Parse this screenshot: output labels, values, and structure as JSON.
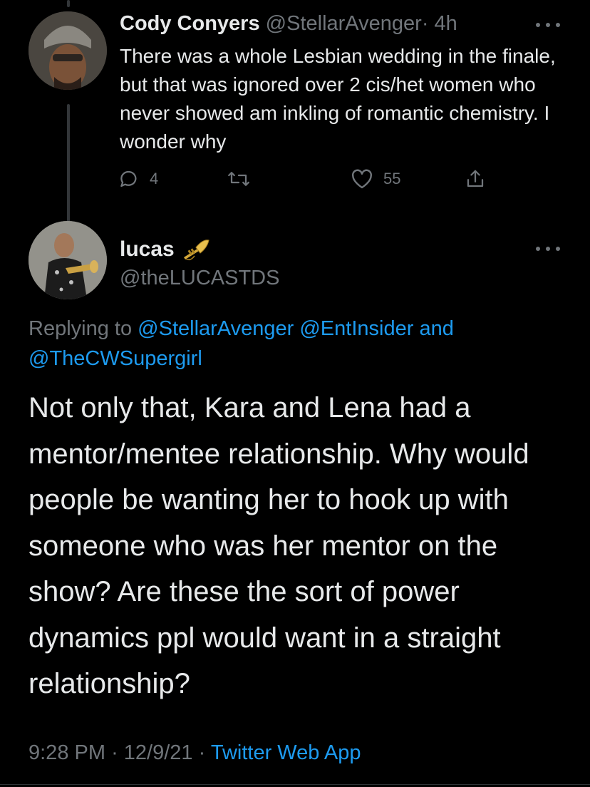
{
  "reply_tweet": {
    "display_name": "Cody Conyers",
    "handle": "@StellarAvenger",
    "separator": "·",
    "time": "4h",
    "text": "There was a whole Lesbian wedding in the finale, but that was ignored over 2 cis/het women who never showed am inkling of romantic chemistry. I wonder why",
    "reply_count": "4",
    "like_count": "55"
  },
  "main_tweet": {
    "display_name": "lucas",
    "emoji_icon": "trumpet-icon",
    "handle": "@theLUCASTDS",
    "replying_prefix": "Replying to",
    "mention_1": "@StellarAvenger",
    "mention_2": "@EntInsider",
    "conjunction": "and",
    "mention_3": "@TheCWSupergirl",
    "text": "Not only that, Kara and Lena had a mentor/mentee relationship. Why would people be wanting her to hook up with someone who was her mentor on the show? Are these the sort of power dynamics ppl would want in a straight relationship?",
    "time": "9:28 PM",
    "date": "12/9/21",
    "separator": "·",
    "source": "Twitter Web App"
  },
  "colors": {
    "background": "#000000",
    "text": "#e7e9ea",
    "muted": "#71767b",
    "link": "#1d9bf0"
  }
}
